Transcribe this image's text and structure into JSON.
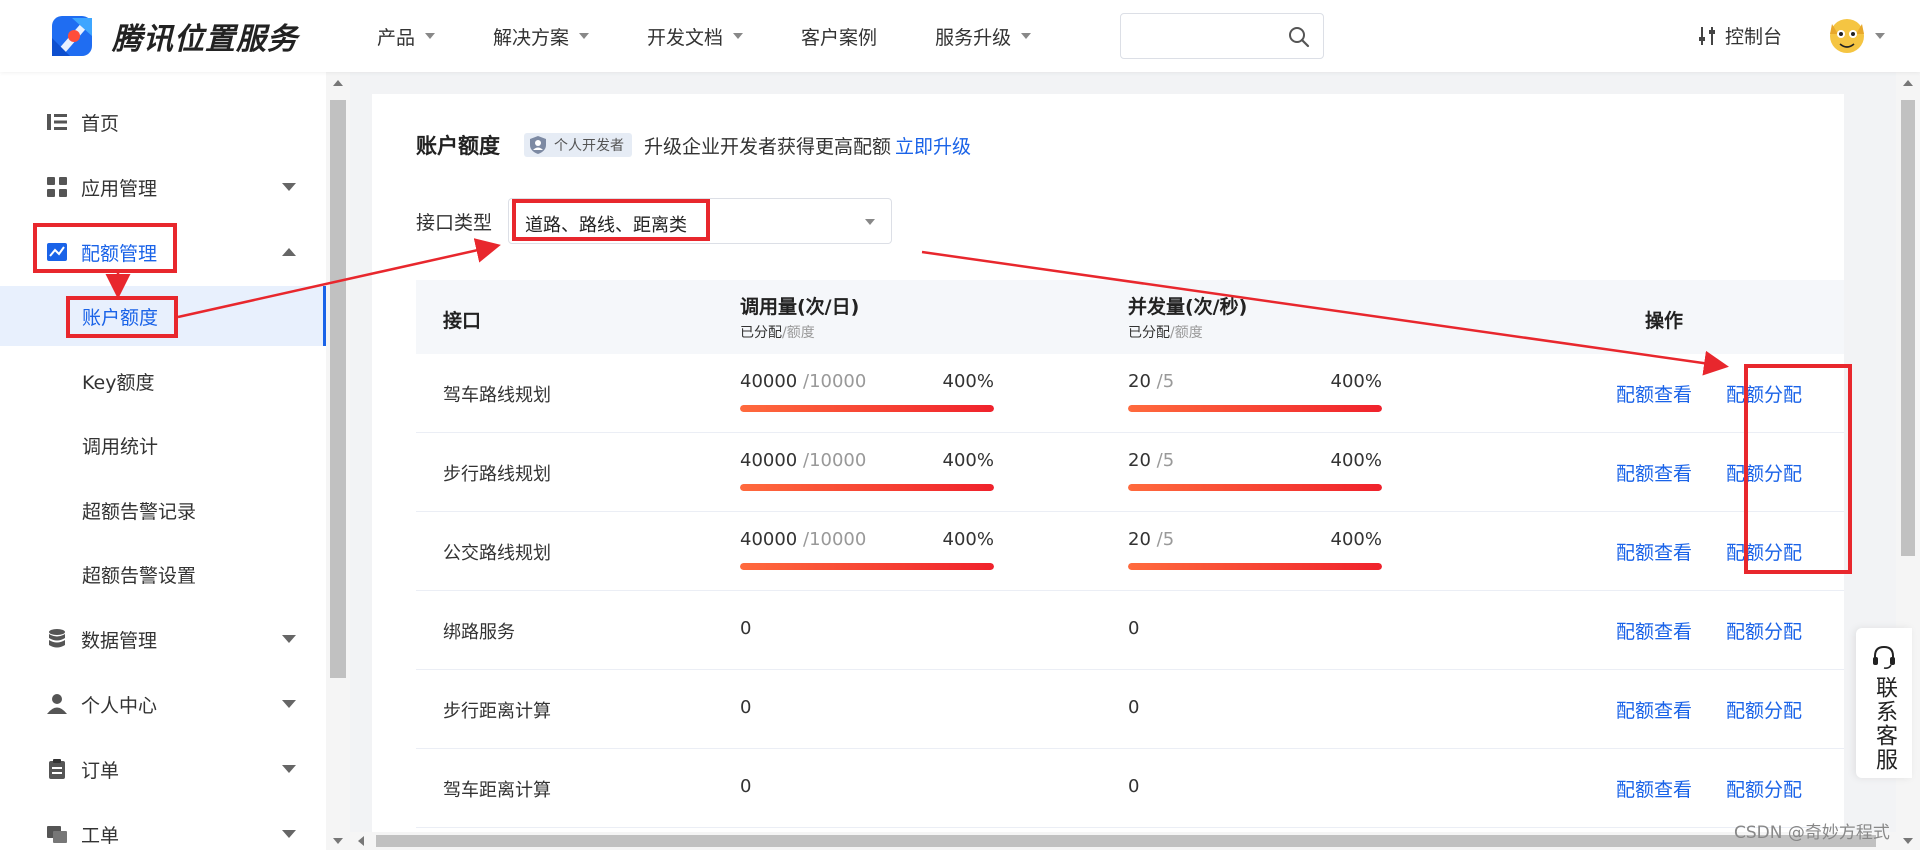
{
  "header": {
    "logo_text": "腾讯位置服务",
    "nav": [
      {
        "label": "产品",
        "dropdown": true
      },
      {
        "label": "解决方案",
        "dropdown": true
      },
      {
        "label": "开发文档",
        "dropdown": true
      },
      {
        "label": "客户案例",
        "dropdown": false
      },
      {
        "label": "服务升级",
        "dropdown": true
      }
    ],
    "search_placeholder": "",
    "console_label": "控制台"
  },
  "sidebar": {
    "items": [
      {
        "label": "首页",
        "icon": "list-icon"
      },
      {
        "label": "应用管理",
        "icon": "grid-icon",
        "expandable": true
      },
      {
        "label": "配额管理",
        "icon": "chart-icon",
        "expandable": true,
        "expanded": true
      },
      {
        "label": "数据管理",
        "icon": "database-icon",
        "expandable": true
      },
      {
        "label": "个人中心",
        "icon": "user-icon",
        "expandable": true
      },
      {
        "label": "订单",
        "icon": "clipboard-icon",
        "expandable": true
      },
      {
        "label": "工单",
        "icon": "ticket-icon",
        "expandable": true
      }
    ],
    "sub_items": [
      {
        "label": "账户额度",
        "active": true
      },
      {
        "label": "Key额度"
      },
      {
        "label": "调用统计"
      },
      {
        "label": "超额告警记录"
      },
      {
        "label": "超额告警设置"
      }
    ]
  },
  "main": {
    "title": "账户额度",
    "badge": "个人开发者",
    "upgrade_tip": "升级企业开发者获得更高配额",
    "upgrade_link": "立即升级",
    "filter_label": "接口类型",
    "filter_value": "道路、路线、距离类",
    "table": {
      "columns": {
        "api": "接口",
        "daily": "调用量(次/日)",
        "daily_sub_a": "已分配",
        "daily_sub_b": "/额度",
        "concurrency": "并发量(次/秒)",
        "conc_sub_a": "已分配",
        "conc_sub_b": "/额度",
        "ops": "操作"
      },
      "rows": [
        {
          "name": "驾车路线规划",
          "daily_used": "40000",
          "daily_cap": "/10000",
          "daily_pct": "400%",
          "daily_frac": 1.0,
          "conc_used": "20",
          "conc_cap": "/5",
          "conc_pct": "400%",
          "conc_frac": 1.0,
          "has_bar": true
        },
        {
          "name": "步行路线规划",
          "daily_used": "40000",
          "daily_cap": "/10000",
          "daily_pct": "400%",
          "daily_frac": 1.0,
          "conc_used": "20",
          "conc_cap": "/5",
          "conc_pct": "400%",
          "conc_frac": 1.0,
          "has_bar": true
        },
        {
          "name": "公交路线规划",
          "daily_used": "40000",
          "daily_cap": "/10000",
          "daily_pct": "400%",
          "daily_frac": 1.0,
          "conc_used": "20",
          "conc_cap": "/5",
          "conc_pct": "400%",
          "conc_frac": 1.0,
          "has_bar": true
        },
        {
          "name": "绑路服务",
          "daily_used": "0",
          "conc_used": "0",
          "has_bar": false
        },
        {
          "name": "步行距离计算",
          "daily_used": "0",
          "conc_used": "0",
          "has_bar": false
        },
        {
          "name": "驾车距离计算",
          "daily_used": "0",
          "conc_used": "0",
          "has_bar": false
        }
      ],
      "op_view": "配额查看",
      "op_assign": "配额分配"
    }
  },
  "service_label": "联系客服",
  "watermark": "CSDN @奇妙方程式",
  "colors": {
    "accent": "#1a63e8",
    "annotation": "#e8272d",
    "bar_start": "#ff6a3d",
    "bar_end": "#f0222c"
  }
}
